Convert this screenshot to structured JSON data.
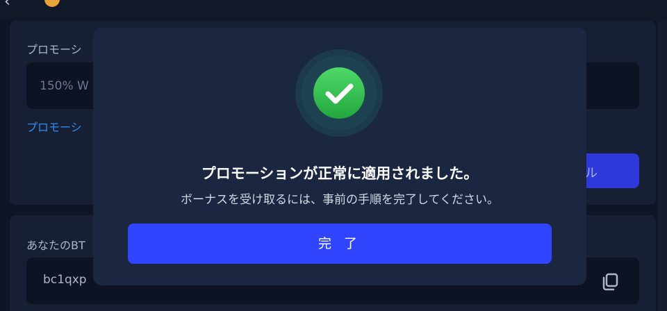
{
  "background": {
    "topbar": {
      "back_icon": "arrow-left-icon",
      "coin_icon": "coin-icon"
    },
    "promo_label": "プロモーシ",
    "promo_value": "150% W",
    "promo_link": "プロモーシ",
    "cancel_button_label": "セル",
    "address_label": "あなたのBT",
    "address_value": "bc1qxp",
    "copy_icon": "copy-icon"
  },
  "modal": {
    "icon": "check-circle-icon",
    "title": "プロモーションが正常に適用されました。",
    "subtitle": "ボーナスを受け取るには、事前の手順を完了してください。",
    "done_button": "完 了"
  },
  "colors": {
    "accent": "#3145ff",
    "success": "#34c759",
    "modal_bg": "#1b2640",
    "page_bg": "#0f1524"
  }
}
